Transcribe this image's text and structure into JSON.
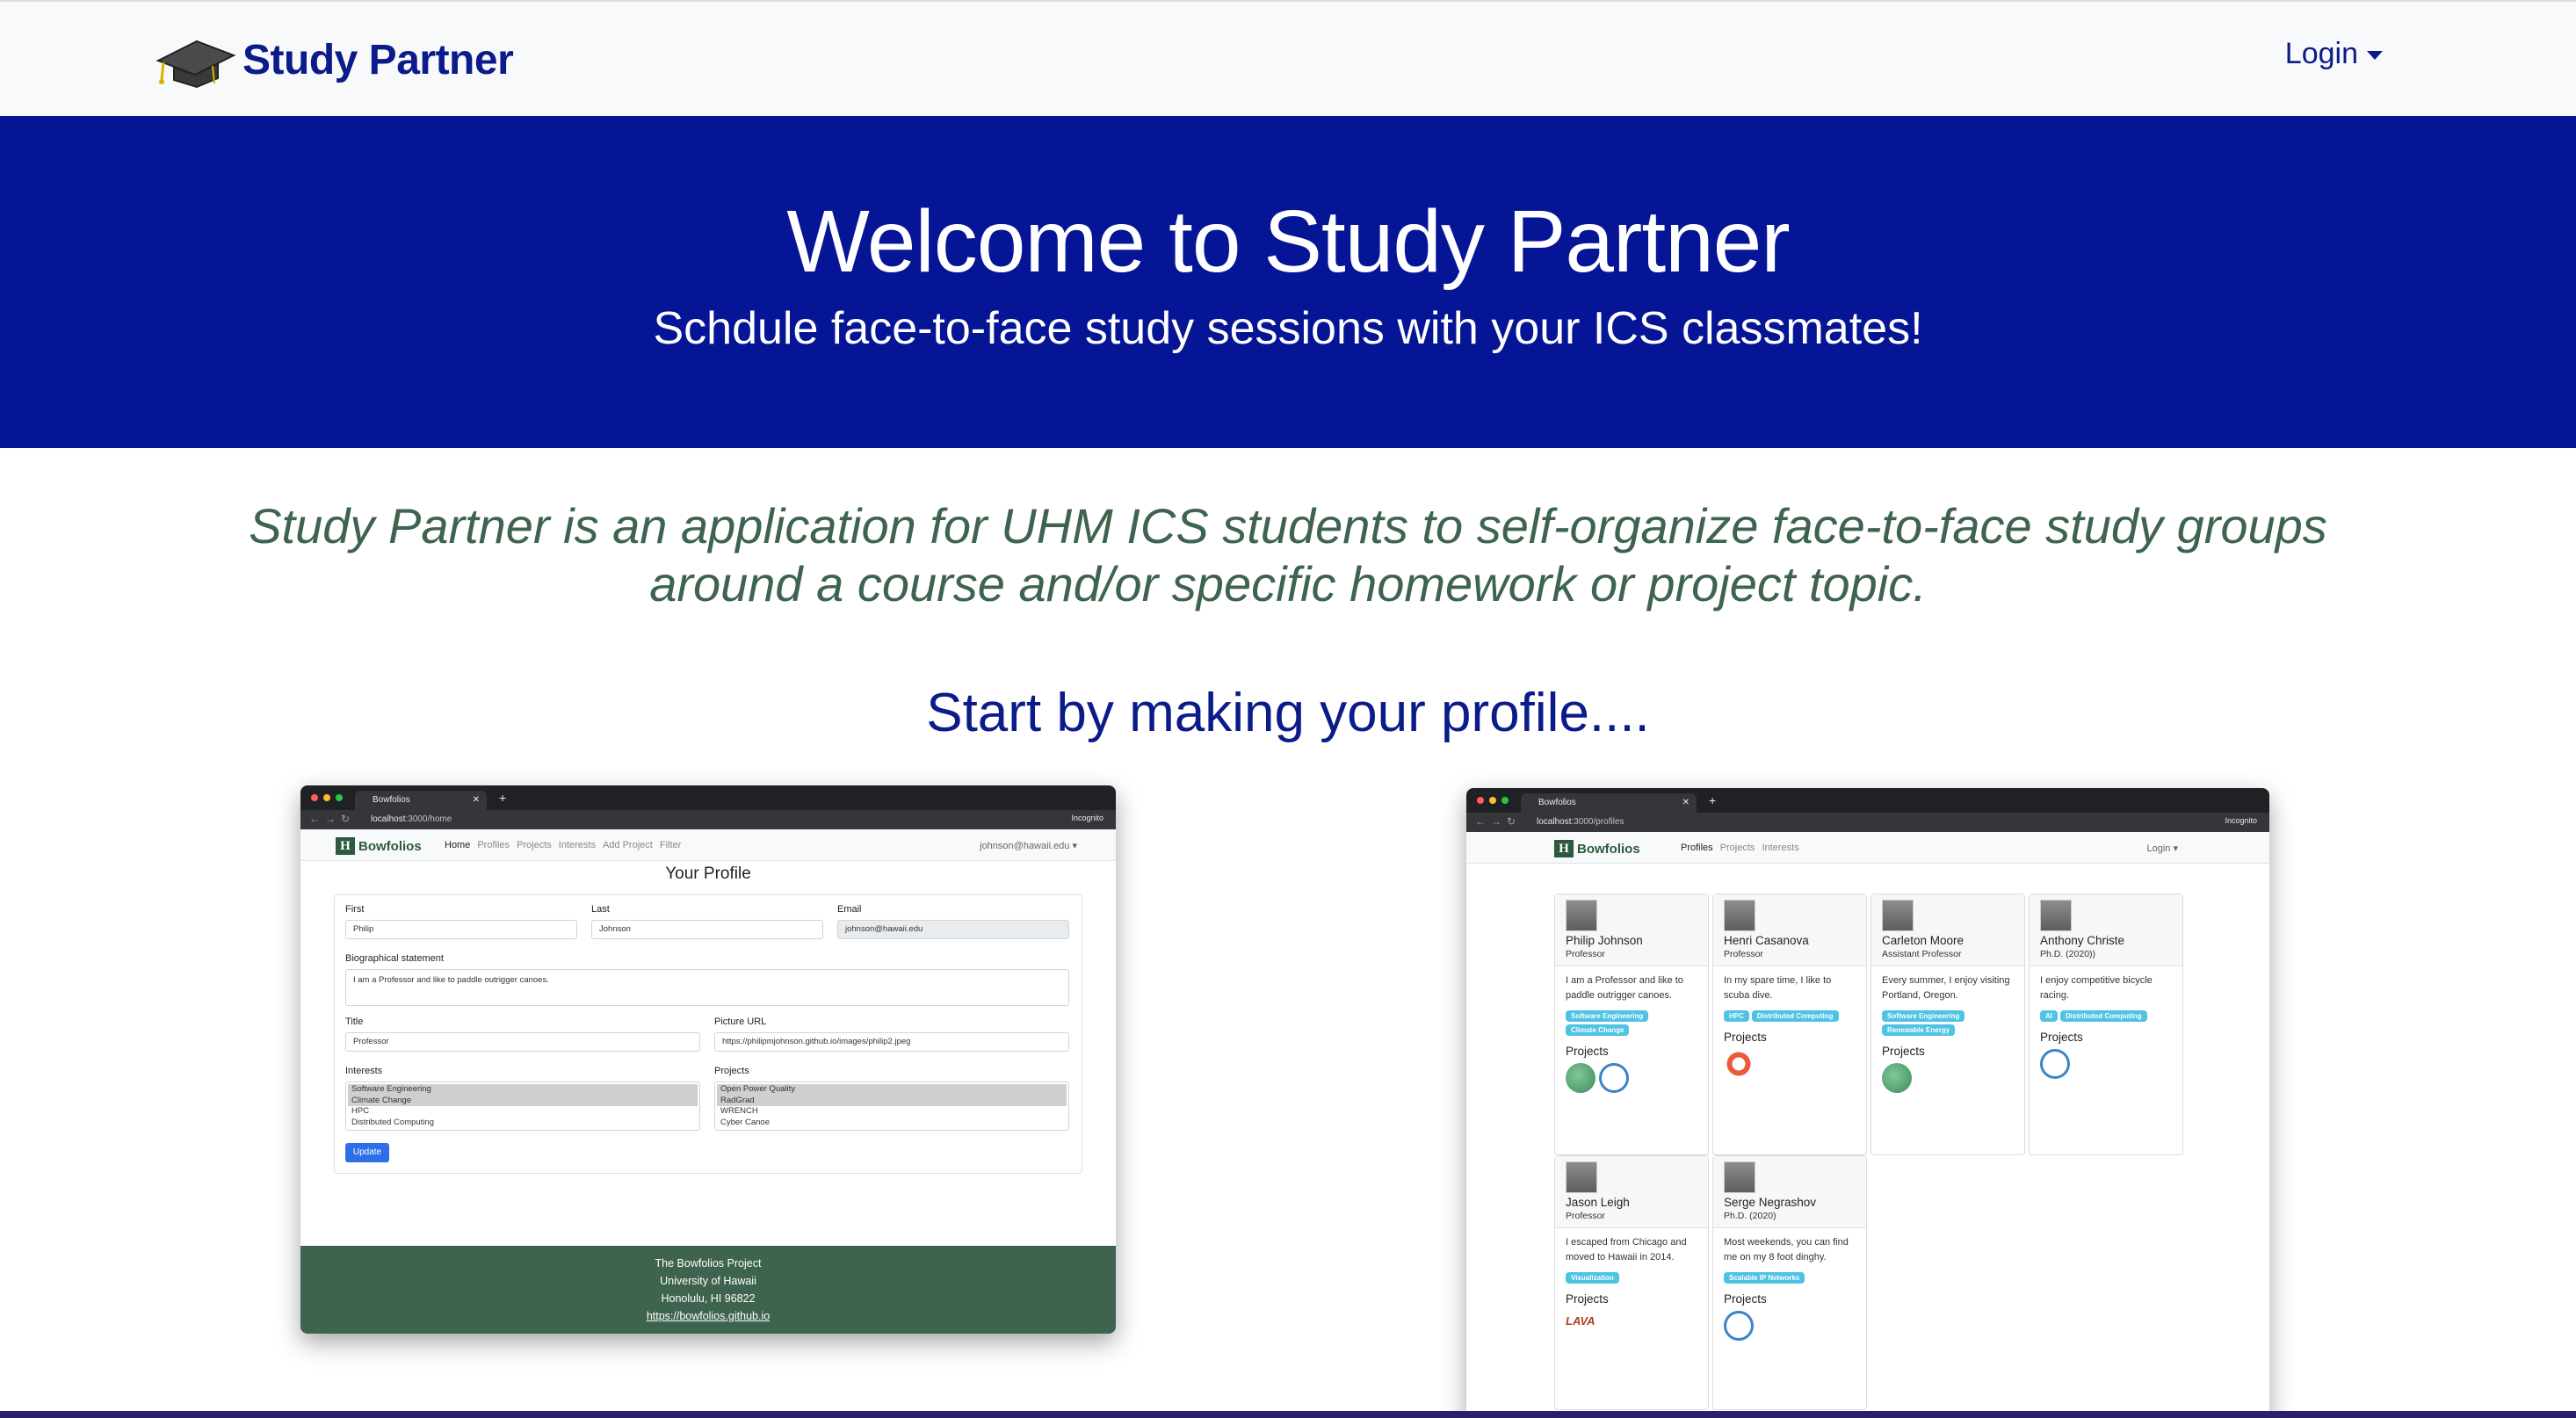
{
  "nav": {
    "brand": "Study Partner",
    "login": "Login"
  },
  "hero": {
    "title": "Welcome to Study Partner",
    "subtitle": "Schdule face-to-face study sessions with your ICS classmates!"
  },
  "intro": {
    "text": "Study Partner is an application for UHM ICS students to self-organize face-to-face study groups around a course and/or specific homework or project topic.",
    "start": "Start by making your profile...."
  },
  "shot_home": {
    "tab": "Bowfolios",
    "url_host": "localhost",
    "url_path": ":3000/home",
    "incognito": "Incognito",
    "brand": "Bowfolios",
    "links": [
      "Home",
      "Profiles",
      "Projects",
      "Interests",
      "Add Project",
      "Filter"
    ],
    "user": "johnson@hawaii.edu",
    "page_title": "Your Profile",
    "first_label": "First",
    "first_value": "Philip",
    "last_label": "Last",
    "last_value": "Johnson",
    "email_label": "Email",
    "email_value": "johnson@hawaii.edu",
    "bio_label": "Biographical statement",
    "bio_value": "I am a Professor and like to paddle outrigger canoes.",
    "title_label": "Title",
    "title_value": "Professor",
    "picture_label": "Picture URL",
    "picture_value": "https://philipmjohnson.github.io/images/philip2.jpeg",
    "interests_label": "Interests",
    "interests": [
      "Software Engineering",
      "Climate Change",
      "HPC",
      "Distributed Computing"
    ],
    "projects_label": "Projects",
    "projects": [
      "Open Power Quality",
      "RadGrad",
      "WRENCH",
      "Cyber Canoe"
    ],
    "update": "Update",
    "footer": [
      "The Bowfolios Project",
      "University of Hawaii",
      "Honolulu, HI 96822",
      "https://bowfolios.github.io"
    ]
  },
  "shot_profiles": {
    "tab": "Bowfolios",
    "url_host": "localhost",
    "url_path": ":3000/profiles",
    "incognito": "Incognito",
    "brand": "Bowfolios",
    "links": [
      "Profiles",
      "Projects",
      "Interests"
    ],
    "login": "Login",
    "projects_label": "Projects",
    "cards": [
      {
        "name": "Philip Johnson",
        "title": "Professor",
        "bio": "I am a Professor and like to paddle outrigger canoes.",
        "tags": [
          "Software Engineering",
          "Climate Change"
        ]
      },
      {
        "name": "Henri Casanova",
        "title": "Professor",
        "bio": "In my spare time, I like to scuba dive.",
        "tags": [
          "HPC",
          "Distributed Computing"
        ]
      },
      {
        "name": "Carleton Moore",
        "title": "Assistant Professor",
        "bio": "Every summer, I enjoy visiting Portland, Oregon.",
        "tags": [
          "Software Engineering",
          "Renewable Energy"
        ]
      },
      {
        "name": "Anthony Christe",
        "title": "Ph.D. (2020))",
        "bio": "I enjoy competitive bicycle racing.",
        "tags": [
          "AI",
          "Distributed Computing"
        ]
      },
      {
        "name": "Jason Leigh",
        "title": "Professor",
        "bio": "I escaped from Chicago and moved to Hawaii in 2014.",
        "tags": [
          "Visualization"
        ]
      },
      {
        "name": "Serge Negrashov",
        "title": "Ph.D. (2020)",
        "bio": "Most weekends, you can find me on my 8 foot dinghy.",
        "tags": [
          "Scalable IP Networks"
        ]
      }
    ],
    "lava": "LAVA"
  }
}
